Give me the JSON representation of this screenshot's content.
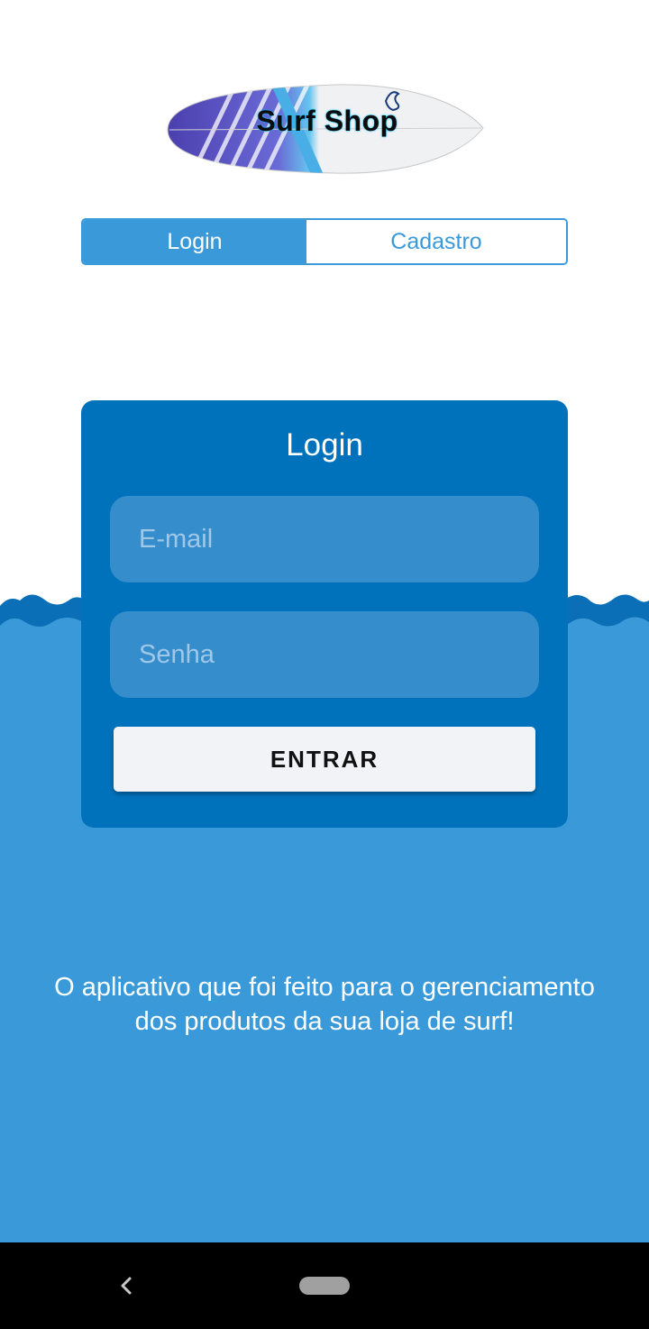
{
  "logo": {
    "text": "Surf Shop"
  },
  "tabs": {
    "login_label": "Login",
    "cadastro_label": "Cadastro"
  },
  "login_card": {
    "title": "Login",
    "email_placeholder": "E-mail",
    "senha_placeholder": "Senha",
    "submit_label": "ENTRAR"
  },
  "tagline": "O aplicativo que foi feito para o gerenciamento dos produtos da sua loja de surf!",
  "navigation": {
    "back_icon": "chevron-left-icon",
    "home_icon": "home-pill-icon"
  },
  "colors": {
    "primary": "#3a9ad9",
    "card": "#0072bc",
    "field": "#358dcb",
    "button": "#f2f3f7",
    "navbar": "#000000"
  }
}
